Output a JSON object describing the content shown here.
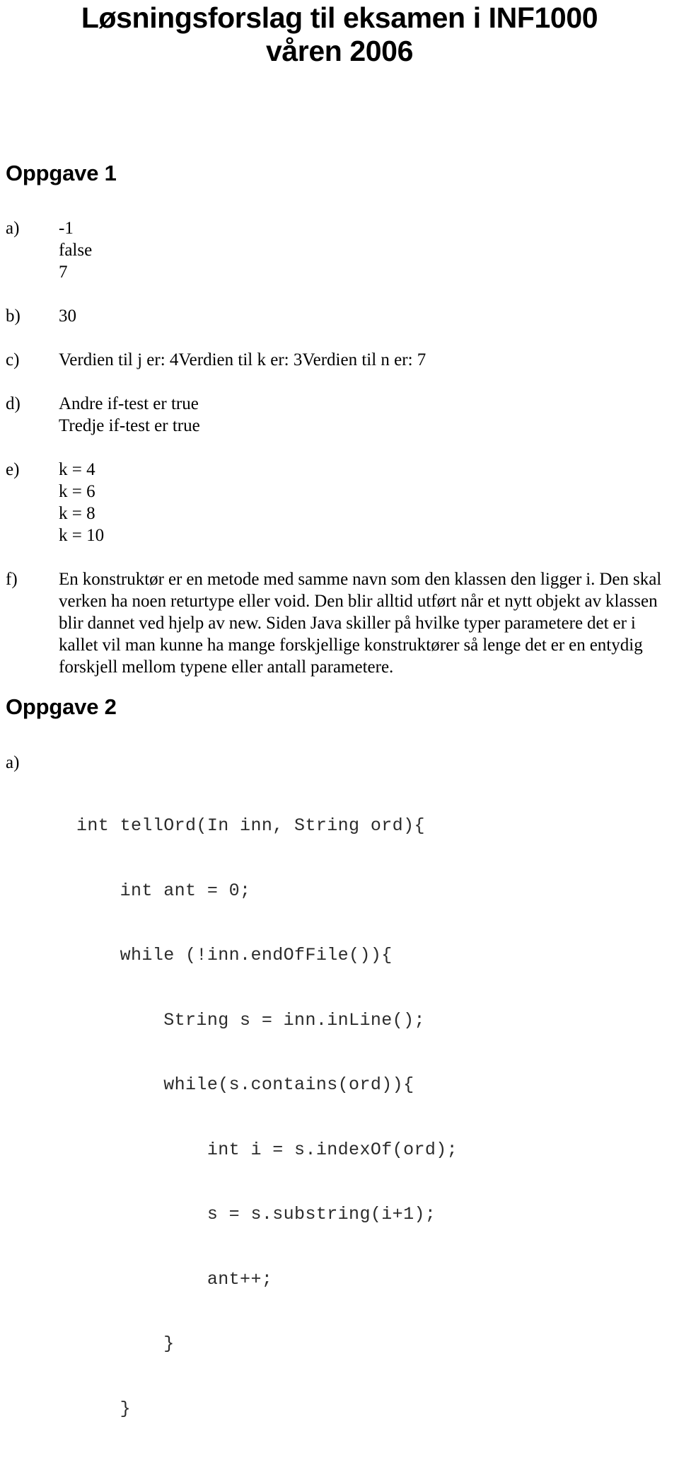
{
  "document": {
    "title_lines": [
      "Løsningsforslag til eksamen i INF1000",
      "våren 2006"
    ]
  },
  "sections": {
    "oppgave1": {
      "heading": "Oppgave 1",
      "items": {
        "a": {
          "label": "a)",
          "lines": [
            "-1",
            "false",
            "7"
          ]
        },
        "b": {
          "label": "b)",
          "lines": [
            "30"
          ]
        },
        "c": {
          "label": "c)",
          "lines": [
            "Verdien til j er: 4Verdien til k er: 3Verdien til n er: 7"
          ]
        },
        "d": {
          "label": "d)",
          "lines": [
            "Andre if-test er true",
            "Tredje if-test er true"
          ]
        },
        "e": {
          "label": "e)",
          "lines": [
            "k = 4",
            "k = 6",
            "k = 8",
            "k = 10"
          ]
        },
        "f": {
          "label": "f)",
          "paragraph": "En konstruktør er en metode med samme navn som den klassen den ligger i. Den skal verken ha noen returtype eller void. Den blir alltid utført når et nytt objekt av klassen blir dannet ved hjelp av new. Siden Java skiller på hvilke typer parametere det er i kallet vil man kunne ha mange forskjellige konstruktører så lenge det er en entydig forskjell mellom typene eller antall parametere."
        }
      }
    },
    "oppgave2": {
      "heading": "Oppgave 2",
      "items": {
        "a": {
          "label": "a)",
          "code_lines": [
            "int tellOrd(In inn, String ord){",
            "    int ant = 0;",
            "    while (!inn.endOfFile()){",
            "        String s = inn.inLine();",
            "        while(s.contains(ord)){",
            "            int i = s.indexOf(ord);",
            "            s = s.substring(i+1);",
            "            ant++;",
            "        }",
            "    }"
          ]
        }
      }
    }
  },
  "colors": {
    "page_background": "#ffffff",
    "text": "#000000",
    "code_text": "#2b2b2b"
  }
}
